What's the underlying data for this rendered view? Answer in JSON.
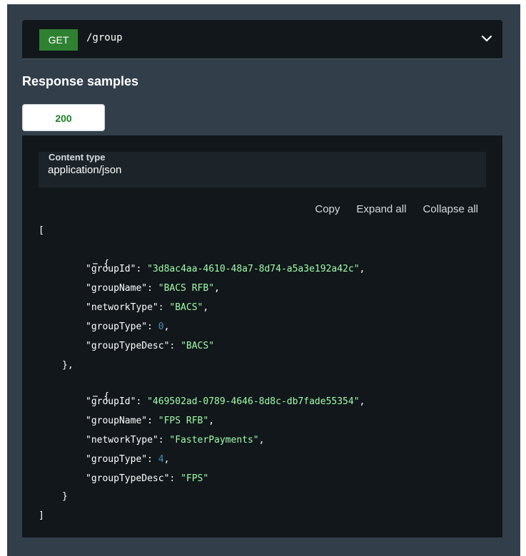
{
  "endpoint": {
    "method": "GET",
    "path": "/group"
  },
  "section": {
    "title": "Response samples"
  },
  "response": {
    "status": "200",
    "content_type_label": "Content type",
    "content_type_value": "application/json",
    "actions": {
      "copy": "Copy",
      "expand_all": "Expand all",
      "collapse_all": "Collapse all"
    }
  },
  "json": {
    "open_bracket": "[",
    "close_bracket": "]",
    "toggle": "−",
    "open_brace": "{",
    "close_brace_comma": "},",
    "close_brace": "}",
    "items": [
      {
        "groupId_key": "\"groupId\"",
        "groupId_val": "\"3d8ac4aa-4610-48a7-8d74-a5a3e192a42c\"",
        "groupName_key": "\"groupName\"",
        "groupName_val": "\"BACS RFB\"",
        "networkType_key": "\"networkType\"",
        "networkType_val": "\"BACS\"",
        "groupType_key": "\"groupType\"",
        "groupType_val": "0",
        "groupTypeDesc_key": "\"groupTypeDesc\"",
        "groupTypeDesc_val": "\"BACS\""
      },
      {
        "groupId_key": "\"groupId\"",
        "groupId_val": "\"469502ad-0789-4646-8d8c-db7fade55354\"",
        "groupName_key": "\"groupName\"",
        "groupName_val": "\"FPS RFB\"",
        "networkType_key": "\"networkType\"",
        "networkType_val": "\"FasterPayments\"",
        "groupType_key": "\"groupType\"",
        "groupType_val": "4",
        "groupTypeDesc_key": "\"groupTypeDesc\"",
        "groupTypeDesc_val": "\"FPS\""
      }
    ]
  },
  "colors": {
    "panel_bg": "#323f4b",
    "code_bg": "#11171a",
    "get_badge": "#2f8132",
    "string": "#a0fbaa",
    "number": "#4a8bb3"
  }
}
